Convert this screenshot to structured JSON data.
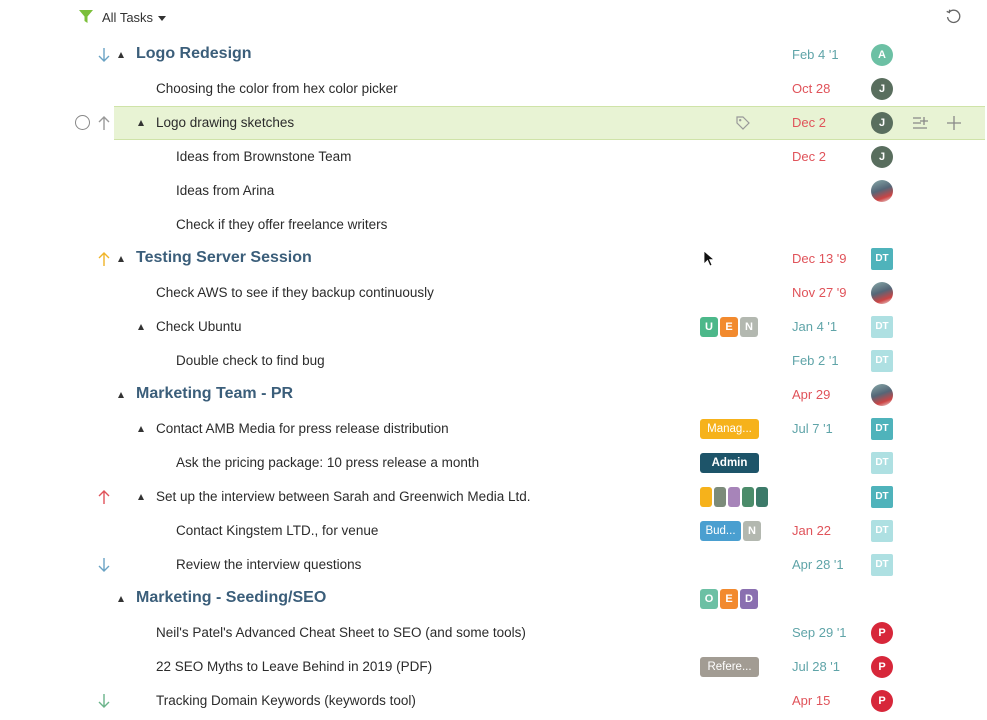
{
  "toolbar": {
    "filter_label": "All Tasks",
    "filter_icon": "funnel-icon",
    "refresh_icon": "refresh-icon",
    "filter_color": "#7bbf3a"
  },
  "colors": {
    "group_title": "#3b5e7a",
    "overdue_date": "#e0535a",
    "normal_date": "#5fa4a8",
    "selected_row": "#e8f3d4"
  },
  "rows": [
    {
      "title": "Logo Redesign",
      "date": "Feb 4 '1",
      "avatar": "A"
    },
    {
      "title": "Choosing the color from hex color picker",
      "date": "Oct 28",
      "avatar": "J"
    },
    {
      "title": "Logo drawing sketches",
      "date": "Dec 2",
      "avatar": "J"
    },
    {
      "title": "Ideas from Brownstone Team",
      "date": "Dec 2",
      "avatar": "J"
    },
    {
      "title": "Ideas from Arina",
      "avatar": "photo"
    },
    {
      "title": "Check if they offer freelance writers"
    },
    {
      "title": "Testing Server Session",
      "date": "Dec 13 '9",
      "avatar": "DT"
    },
    {
      "title": "Check AWS to see if they backup continuously",
      "date": "Nov 27 '9",
      "avatar": "photo"
    },
    {
      "title": "Check Ubuntu",
      "date": "Jan 4 '1",
      "avatar": "DT",
      "tags": [
        "U",
        "E",
        "N"
      ]
    },
    {
      "title": "Double check to find bug",
      "date": "Feb 2 '1",
      "avatar": "DT"
    },
    {
      "title": "Marketing Team - PR",
      "date": "Apr 29",
      "avatar": "photo"
    },
    {
      "title": "Contact AMB Media for press release distribution",
      "date": "Jul 7 '1",
      "avatar": "DT",
      "tags": [
        "Manag..."
      ]
    },
    {
      "title": "Ask the pricing package: 10 press release a month",
      "avatar": "DT",
      "tags": [
        "Admin"
      ]
    },
    {
      "title": "Set up the interview between Sarah and Greenwich Media Ltd.",
      "avatar": "DT"
    },
    {
      "title": "Contact Kingstem LTD., for venue",
      "date": "Jan 22",
      "avatar": "DT",
      "tags": [
        "Bud...",
        "N"
      ]
    },
    {
      "title": "Review the interview questions",
      "date": "Apr 28 '1",
      "avatar": "DT"
    },
    {
      "title": "Marketing - Seeding/SEO",
      "tags": [
        "O",
        "E",
        "D"
      ]
    },
    {
      "title": "Neil's Patel's Advanced Cheat Sheet to SEO (and some tools)",
      "date": "Sep 29 '1",
      "avatar": "P"
    },
    {
      "title": "22 SEO Myths to Leave Behind in 2019 (PDF)",
      "date": "Jul 28 '1",
      "avatar": "P",
      "tags": [
        "Refere..."
      ]
    },
    {
      "title": "Tracking Domain Keywords (keywords tool)",
      "date": "Apr 15",
      "avatar": "P"
    }
  ]
}
